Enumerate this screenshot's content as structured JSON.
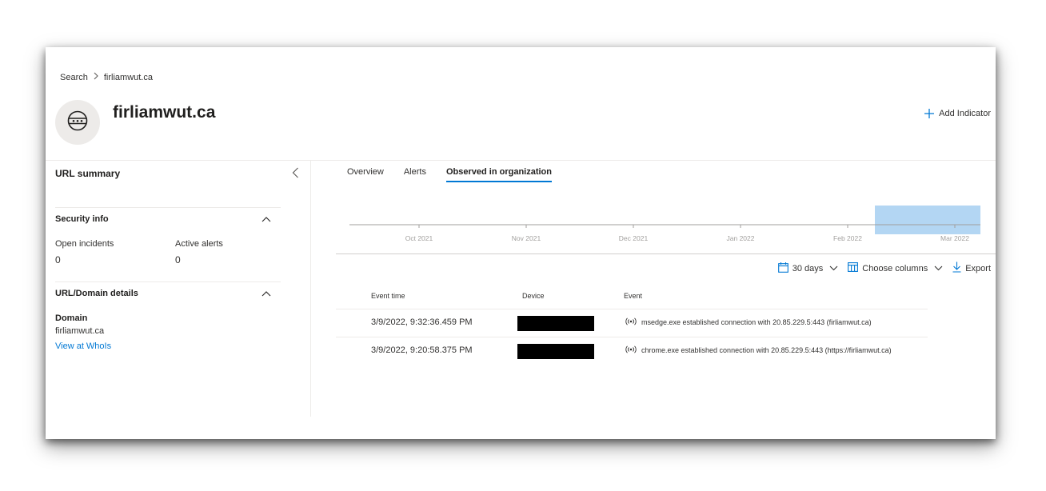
{
  "breadcrumb": {
    "root": "Search",
    "current": "firliamwut.ca"
  },
  "header": {
    "title": "firliamwut.ca",
    "add_indicator": "Add Indicator"
  },
  "summary": {
    "title": "URL summary",
    "security_info": {
      "title": "Security info",
      "open_incidents_label": "Open incidents",
      "open_incidents_value": "0",
      "active_alerts_label": "Active alerts",
      "active_alerts_value": "0"
    },
    "domain_details": {
      "title": "URL/Domain details",
      "domain_label": "Domain",
      "domain_value": "firliamwut.ca",
      "whois_link": "View at WhoIs"
    }
  },
  "tabs": [
    {
      "label": "Overview",
      "active": false
    },
    {
      "label": "Alerts",
      "active": false
    },
    {
      "label": "Observed in organization",
      "active": true
    }
  ],
  "timeline": {
    "months": [
      "Oct 2021",
      "Nov 2021",
      "Dec 2021",
      "Jan 2022",
      "Feb 2022",
      "Mar 2022"
    ],
    "selection_range": [
      "Feb 2022",
      "Mar 2022"
    ],
    "selection_color": "#b3d6f3"
  },
  "toolbar": {
    "range": "30 days",
    "choose_columns": "Choose columns",
    "export": "Export"
  },
  "table": {
    "columns": [
      "Event time",
      "Device",
      "Event"
    ],
    "rows": [
      {
        "time": "3/9/2022, 9:32:36.459 PM",
        "device": "",
        "event": "msedge.exe established connection with 20.85.229.5:443 (firliamwut.ca)"
      },
      {
        "time": "3/9/2022, 9:20:58.375 PM",
        "device": "",
        "event": "chrome.exe established connection with 20.85.229.5:443 (https://firliamwut.ca)"
      }
    ]
  },
  "colors": {
    "accent": "#0078d4",
    "text": "#201f1e",
    "divider": "#edebe9"
  }
}
